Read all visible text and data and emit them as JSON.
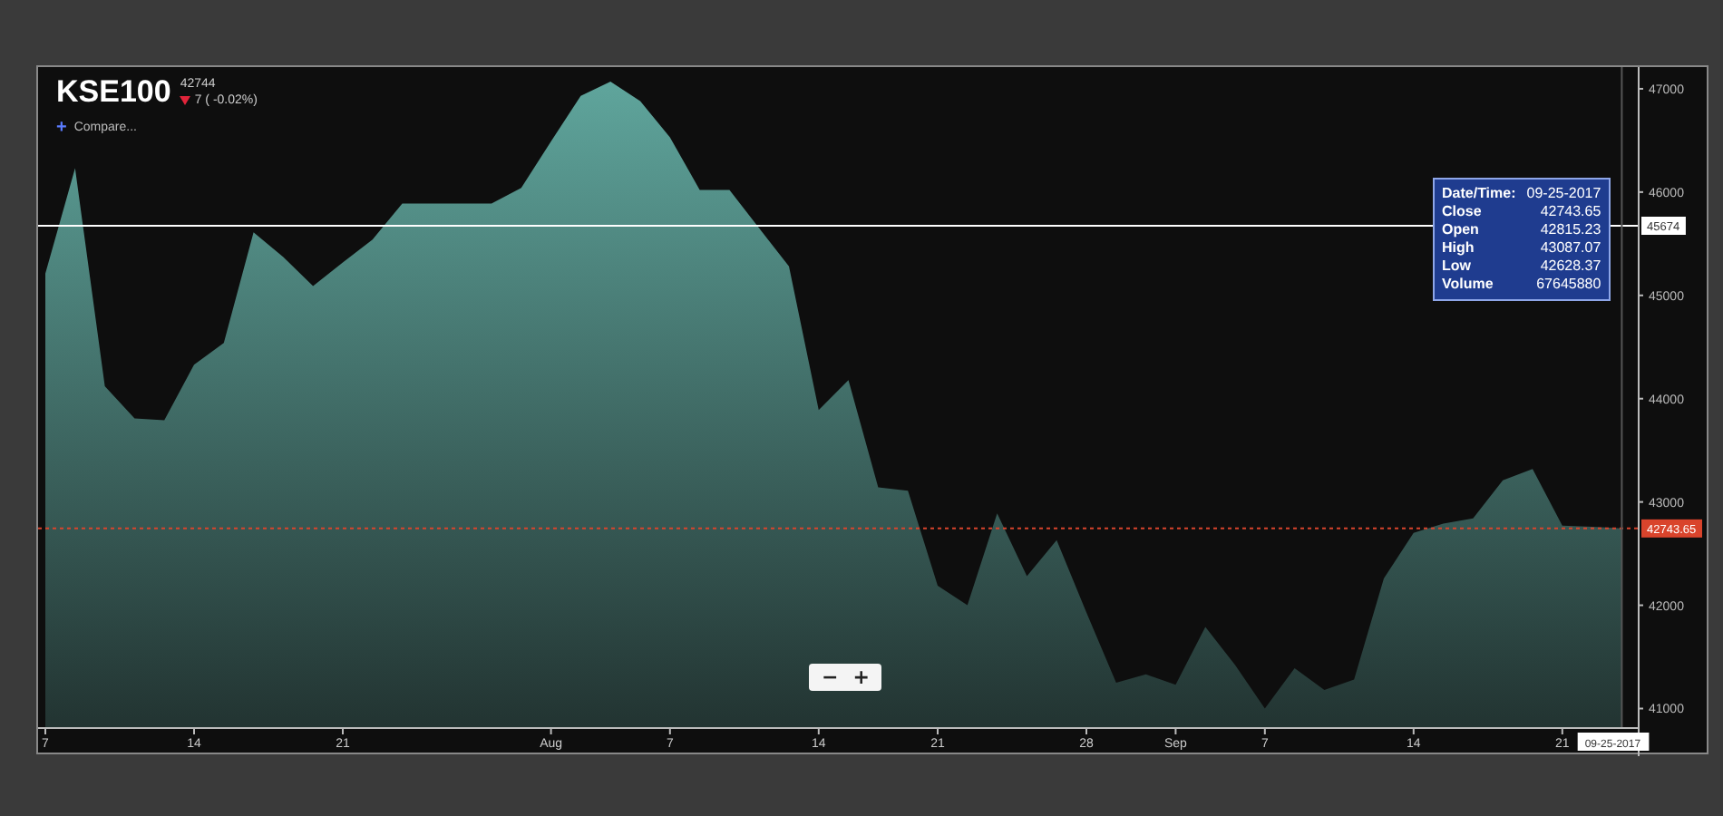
{
  "chart": {
    "symbol": "KSE100",
    "last": "42744",
    "change": {
      "down": true,
      "text": "7 ( -0.02%)"
    },
    "compare": {
      "icon": "+",
      "label": "Compare..."
    },
    "tooltip": [
      {
        "label": "Date/Time:",
        "value": "09-25-2017"
      },
      {
        "label": "Close",
        "value": "42743.65"
      },
      {
        "label": "Open",
        "value": "42815.23"
      },
      {
        "label": "High",
        "value": "43087.07"
      },
      {
        "label": "Low",
        "value": "42628.37"
      },
      {
        "label": "Volume",
        "value": "67645880"
      }
    ],
    "zoom_buttons": [
      "−",
      "+"
    ],
    "chart_data": {
      "type": "area",
      "categories": [
        "7",
        null,
        null,
        null,
        null,
        "14",
        null,
        null,
        null,
        null,
        "21",
        null,
        null,
        null,
        null,
        null,
        null,
        "Aug",
        null,
        null,
        null,
        "7",
        null,
        null,
        null,
        null,
        "14",
        null,
        null,
        null,
        "21",
        null,
        null,
        null,
        null,
        "28",
        null,
        null,
        "Sep",
        null,
        null,
        "7",
        null,
        null,
        null,
        null,
        "14",
        null,
        null,
        null,
        null,
        "21",
        null,
        null
      ],
      "series": [
        {
          "color": "#5fa59c",
          "values": [
            45210,
            46230,
            44120,
            43810,
            43790,
            44330,
            44540,
            45610,
            45370,
            45090,
            45320,
            45540,
            45890,
            45890,
            45890,
            45890,
            46040,
            46490,
            46930,
            47070,
            46880,
            46530,
            46020,
            46020,
            45650,
            45280,
            43890,
            44180,
            43140,
            43110,
            42190,
            42000,
            42890,
            42280,
            42630,
            41930,
            41250,
            41330,
            41230,
            41790,
            41420,
            41000,
            41390,
            41180,
            41280,
            42260,
            42700,
            42790,
            42840,
            43210,
            43320,
            42770,
            42760,
            42744
          ]
        }
      ],
      "ylim": [
        40820,
        47210
      ],
      "yticks": [
        {
          "value": 41000,
          "label": "41000"
        },
        {
          "value": 42000,
          "label": "42000"
        },
        {
          "value": 43000,
          "label": "43000"
        },
        {
          "value": 44000,
          "label": "44000"
        },
        {
          "value": 45000,
          "label": "45000"
        },
        {
          "value": 46000,
          "label": "46000"
        },
        {
          "value": 47000,
          "label": "47000"
        }
      ],
      "ref_lines": [
        {
          "axis": "y",
          "value": 45674,
          "label": "45674"
        },
        {
          "axis": "y",
          "value": 42743.65,
          "label": "42743.65"
        }
      ]
    },
    "date_marker": "09-25-2017"
  }
}
